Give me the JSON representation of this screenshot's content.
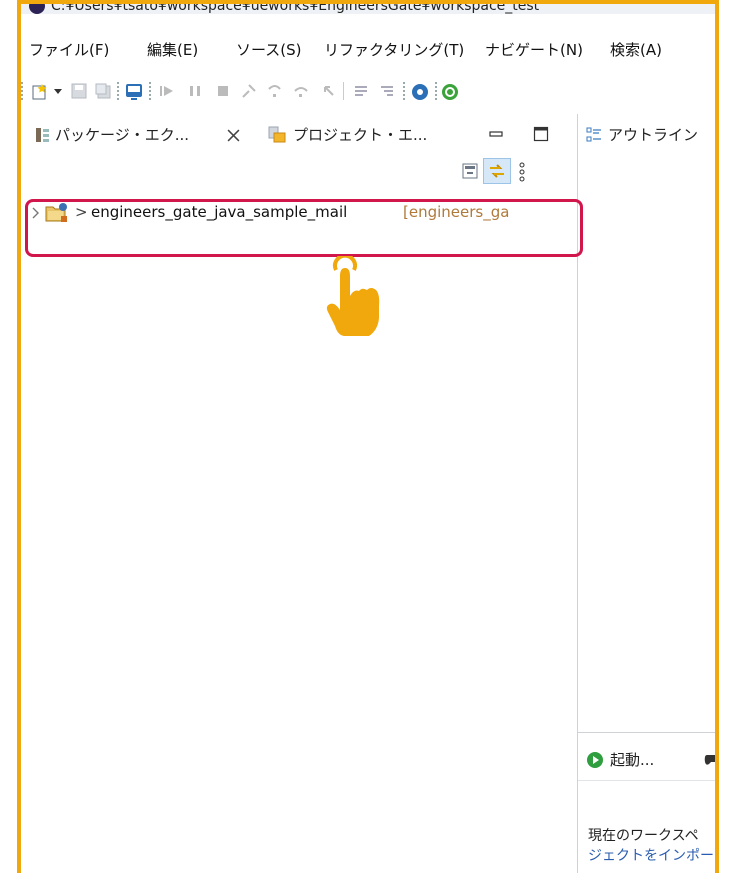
{
  "window": {
    "title_path": "C:¥Users¥tsato¥workspace¥ueworks¥EngineersGate¥workspace_test"
  },
  "menubar": {
    "items": [
      "ファイル(F)",
      "編集(E)",
      "ソース(S)",
      "リファクタリング(T)",
      "ナビゲート(N)",
      "検索(A)"
    ]
  },
  "left_panel": {
    "tabs": [
      {
        "label": "パッケージ・エク...",
        "icon": "package-explorer-icon",
        "closable": true
      },
      {
        "label": "プロジェクト・エ...",
        "icon": "project-explorer-icon",
        "closable": false
      }
    ],
    "view_menu_icon": "vertical-dots-icon",
    "tree": [
      {
        "name": "engineers_gate_java_sample_mail",
        "annotation": "[engineers_ga",
        "prefix": ">"
      }
    ]
  },
  "right_panel": {
    "tab_label": "アウトライン",
    "bottom_tab_label": "起動...",
    "bottom_text_line1": "現在のワークスペ",
    "bottom_text_line2": "ジェクトをインポー"
  },
  "colors": {
    "frame_border": "#f0a80c",
    "highlight_border": "#d0164a",
    "hand_icon": "#f0a80c",
    "link_text": "#2a5db0"
  },
  "annotation": {
    "pointer_icon": "tap-hand-icon"
  }
}
